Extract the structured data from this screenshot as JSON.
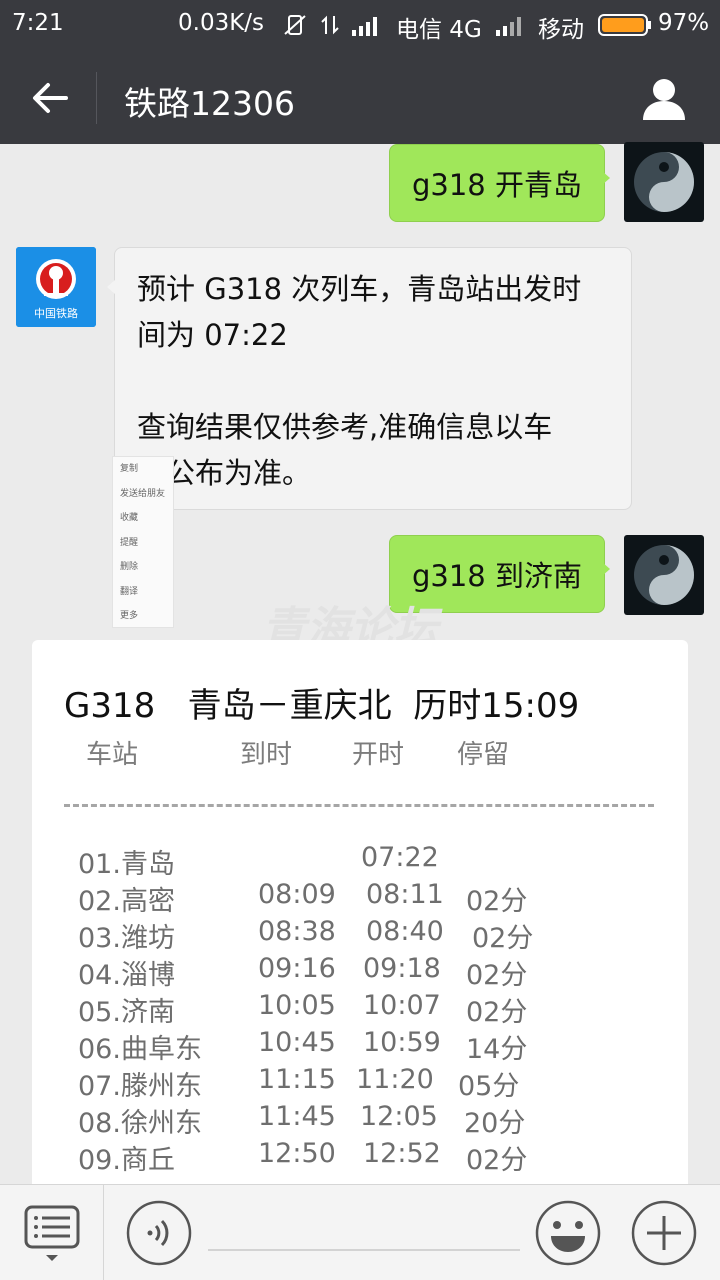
{
  "status_bar": {
    "time": "7:21",
    "net_speed": "0.03K/s",
    "carrier1": "电信 4G",
    "carrier2": "移动",
    "battery": "97%"
  },
  "header": {
    "title": "铁路12306"
  },
  "messages": [
    {
      "from": "me",
      "text": "g318 开青岛"
    },
    {
      "from": "bot",
      "line1": "预计 G318 次列车，青岛站出发时",
      "line2": "间为 07:22",
      "line3": "查询结果仅供参考,准确信息以车",
      "line4": "站公布为准。"
    },
    {
      "from": "me",
      "text": "g318 到济南"
    }
  ],
  "bot_logo_text": "中国铁路",
  "context_menu": [
    "复制",
    "发送给朋友",
    "收藏",
    "提醒",
    "删除",
    "翻译",
    "更多"
  ],
  "watermark": "青海论坛",
  "schedule": {
    "title": "G318   青岛－重庆北  历时15:09",
    "headers": [
      "车站",
      "到时",
      "开时",
      "停留"
    ],
    "rows": [
      {
        "station": "01.青岛",
        "arrive": "",
        "depart": "07:22",
        "stay": ""
      },
      {
        "station": "02.高密",
        "arrive": "08:09",
        "depart": "08:11",
        "stay": "02分"
      },
      {
        "station": "03.潍坊",
        "arrive": "08:38",
        "depart": "08:40",
        "stay": "02分"
      },
      {
        "station": "04.淄博",
        "arrive": "09:16",
        "depart": "09:18",
        "stay": "02分"
      },
      {
        "station": "05.济南",
        "arrive": "10:05",
        "depart": "10:07",
        "stay": "02分"
      },
      {
        "station": "06.曲阜东",
        "arrive": "10:45",
        "depart": "10:59",
        "stay": "14分"
      },
      {
        "station": "07.滕州东",
        "arrive": "11:15",
        "depart": "11:20",
        "stay": "05分"
      },
      {
        "station": "08.徐州东",
        "arrive": "11:45",
        "depart": "12:05",
        "stay": "20分"
      },
      {
        "station": "09.商丘",
        "arrive": "12:50",
        "depart": "12:52",
        "stay": "02分"
      }
    ]
  },
  "icons": {
    "back": "arrow-left-icon",
    "profile": "person-icon",
    "menu": "list-menu-icon",
    "voice": "voice-icon",
    "emoji": "smile-icon",
    "add": "plus-icon"
  },
  "colors": {
    "appbar": "#393a3f",
    "outgoing_bubble": "#a0e75a",
    "incoming_bubble": "#f3f3f3",
    "battery": "#ff9d1c"
  }
}
